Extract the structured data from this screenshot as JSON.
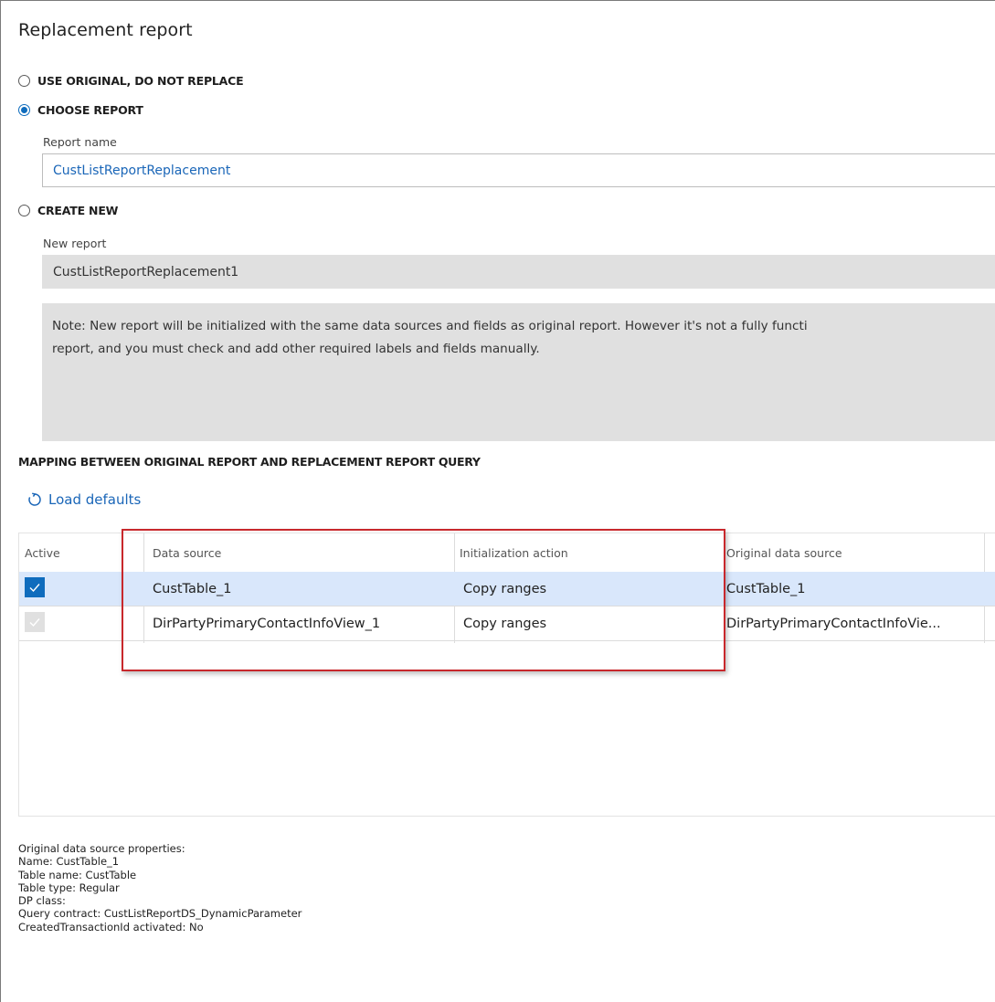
{
  "title": "Replacement report",
  "options": {
    "use_original": "USE ORIGINAL, DO NOT REPLACE",
    "choose_report": "CHOOSE REPORT",
    "create_new": "CREATE NEW",
    "selected": "choose_report"
  },
  "report_name": {
    "label": "Report name",
    "value": "CustListReportReplacement"
  },
  "new_report": {
    "label": "New report",
    "value": "CustListReportReplacement1"
  },
  "note": {
    "line1": "Note: New report will be initialized with the same data sources and fields as original report. However it's not a fully functi",
    "line2": "report, and you must check and add other required labels and fields manually."
  },
  "mapping": {
    "heading": "MAPPING BETWEEN ORIGINAL REPORT AND REPLACEMENT REPORT QUERY",
    "load_defaults": "Load defaults",
    "columns": {
      "active": "Active",
      "data_source": "Data source",
      "init_action": "Initialization action",
      "original_data_source": "Original data source"
    },
    "rows": [
      {
        "active": true,
        "data_source": "CustTable_1",
        "init_action": "Copy ranges",
        "original_data_source": "CustTable_1",
        "selected": true
      },
      {
        "active": false,
        "data_source": "DirPartyPrimaryContactInfoView_1",
        "init_action": "Copy ranges",
        "original_data_source": "DirPartyPrimaryContactInfoVie...",
        "selected": false
      }
    ]
  },
  "properties": {
    "heading": "Original data source properties:",
    "name": "Name: CustTable_1",
    "table_name": "Table name: CustTable",
    "table_type": "Table type: Regular",
    "dp_class": "DP class:",
    "query_contract": "Query contract: CustListReportDS_DynamicParameter",
    "created_tx": "CreatedTransactionId activated: No"
  },
  "colors": {
    "accent": "#0f6cbd",
    "link": "#1a66b8",
    "highlight_border": "#c8282c",
    "selected_row": "#d9e7fb"
  }
}
